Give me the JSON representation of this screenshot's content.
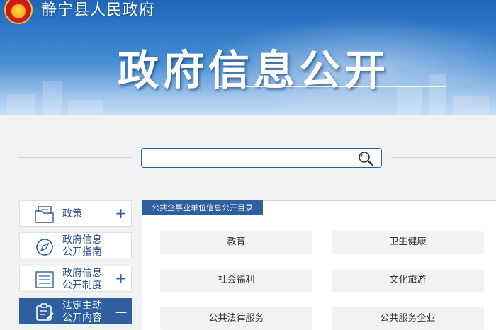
{
  "header": {
    "site_name": "静宁县人民政府",
    "page_title": "政府信息公开"
  },
  "search": {
    "placeholder": "",
    "value": ""
  },
  "sidebar": {
    "items": [
      {
        "label_line1": "政策",
        "label_line2": "",
        "sign": "+"
      },
      {
        "label_line1": "政府信息",
        "label_line2": "公开指南",
        "sign": ""
      },
      {
        "label_line1": "政府信息",
        "label_line2": "公开制度",
        "sign": "+"
      },
      {
        "label_line1": "法定主动",
        "label_line2": "公开内容",
        "sign": "—"
      }
    ]
  },
  "main": {
    "section_title": "公共企事业单位信息公开目录",
    "categories": [
      "教育",
      "卫生健康",
      "社会福利",
      "文化旅游",
      "公共法律服务",
      "公共服务企业"
    ]
  },
  "colors": {
    "primary": "#2f5f9e",
    "banner": "#1f66b8"
  }
}
